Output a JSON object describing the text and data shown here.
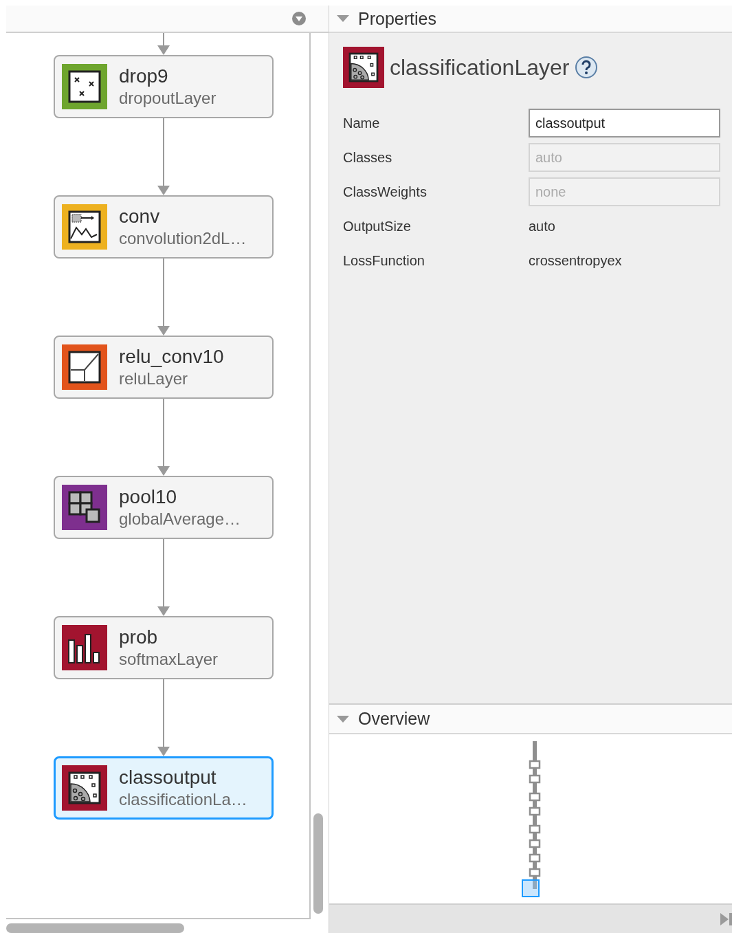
{
  "layers_panel": {
    "layers": [
      {
        "name": "drop9",
        "type": "dropoutLayer",
        "kind": "dropout",
        "color": "#6ea52e",
        "selected": false
      },
      {
        "name": "conv",
        "type": "convolution2dL…",
        "kind": "convolution",
        "color": "#edb120",
        "selected": false
      },
      {
        "name": "relu_conv10",
        "type": "reluLayer",
        "kind": "relu",
        "color": "#e2541c",
        "selected": false
      },
      {
        "name": "pool10",
        "type": "globalAverage…",
        "kind": "pooling",
        "color": "#7e2f8e",
        "selected": false
      },
      {
        "name": "prob",
        "type": "softmaxLayer",
        "kind": "softmax",
        "color": "#a2142f",
        "selected": false
      },
      {
        "name": "classoutput",
        "type": "classificationLa…",
        "kind": "classification",
        "color": "#a2142f",
        "selected": true
      }
    ]
  },
  "properties": {
    "title": "Properties",
    "expanded": true,
    "layer_type": "classificationLayer",
    "kind": "classification",
    "color": "#a2142f",
    "fields": [
      {
        "label": "Name",
        "value": "classoutput",
        "kind": "input",
        "disabled": false
      },
      {
        "label": "Classes",
        "value": "auto",
        "kind": "input",
        "disabled": true
      },
      {
        "label": "ClassWeights",
        "value": "none",
        "kind": "input",
        "disabled": true
      },
      {
        "label": "OutputSize",
        "value": "auto",
        "kind": "text"
      },
      {
        "label": "LossFunction",
        "value": "crossentropyex",
        "kind": "text"
      }
    ]
  },
  "overview": {
    "title": "Overview",
    "expanded": true
  }
}
